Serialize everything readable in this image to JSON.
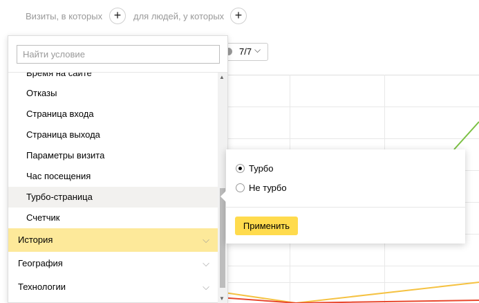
{
  "topbar": {
    "visits_label": "Визиты, в которых",
    "people_label": "для людей, у которых",
    "plus": "+"
  },
  "segment_control": {
    "value": "7/7",
    "chevron": "⌵"
  },
  "dropdown": {
    "search_placeholder": "Найти условие",
    "partial_item": "Время на сайте",
    "items": [
      "Отказы",
      "Страница входа",
      "Страница выхода",
      "Параметры визита",
      "Час посещения",
      "Турбо-страница",
      "Счетчик"
    ],
    "selected_item": "Турбо-страница",
    "categories": [
      {
        "label": "История",
        "active": true
      },
      {
        "label": "География",
        "active": false
      },
      {
        "label": "Технологии",
        "active": false
      }
    ],
    "chevron": "⌵"
  },
  "popover": {
    "options": [
      {
        "label": "Турбо",
        "checked": true
      },
      {
        "label": "Не турбо",
        "checked": false
      }
    ],
    "apply_label": "Применить"
  },
  "colors": {
    "accent_yellow": "#ffdb4d",
    "category_active": "#fde99a",
    "line_green": "#7bc043",
    "line_yellow": "#f5c242",
    "line_red": "#e8482e"
  }
}
